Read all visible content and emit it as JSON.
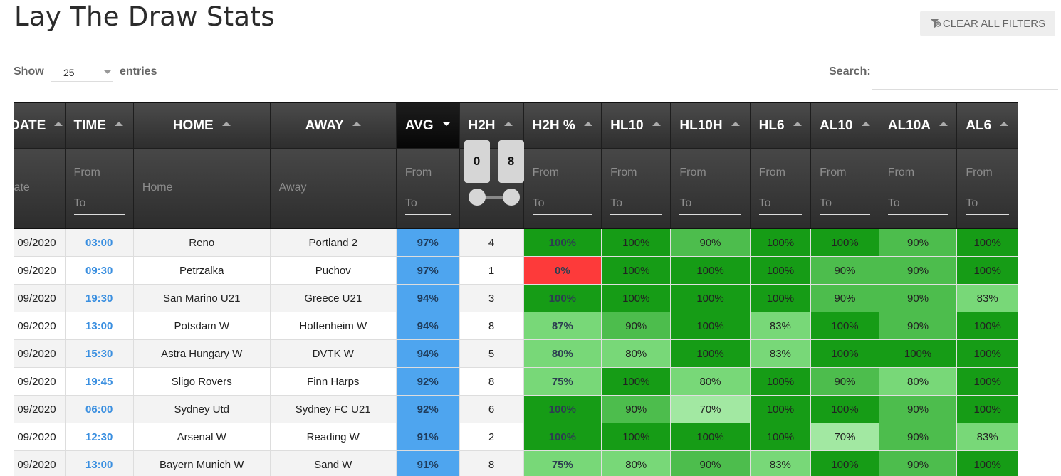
{
  "page": {
    "title": "Lay The Draw Stats",
    "clear_filters_label": "CLEAR ALL FILTERS",
    "clear_filters_icon": "filter-clear-icon"
  },
  "length": {
    "show_label": "Show",
    "selected": "25",
    "entries_label": "entries"
  },
  "search": {
    "label": "Search:",
    "value": "",
    "placeholder": ""
  },
  "columns": [
    {
      "key": "date",
      "label": "DATE",
      "sort": "asc"
    },
    {
      "key": "time",
      "label": "TIME",
      "sort": "asc"
    },
    {
      "key": "home",
      "label": "HOME",
      "sort": "asc"
    },
    {
      "key": "away",
      "label": "AWAY",
      "sort": "asc"
    },
    {
      "key": "avg",
      "label": "AVG",
      "sort": "desc"
    },
    {
      "key": "h2h",
      "label": "H2H",
      "sort": "asc"
    },
    {
      "key": "h2hp",
      "label": "H2H %",
      "sort": "asc"
    },
    {
      "key": "hl10",
      "label": "HL10",
      "sort": "asc"
    },
    {
      "key": "hl10h",
      "label": "HL10H",
      "sort": "asc"
    },
    {
      "key": "hl6",
      "label": "HL6",
      "sort": "asc"
    },
    {
      "key": "al10",
      "label": "AL10",
      "sort": "asc"
    },
    {
      "key": "al10a",
      "label": "AL10A",
      "sort": "asc"
    },
    {
      "key": "al6",
      "label": "AL6",
      "sort": "asc"
    }
  ],
  "filters": {
    "date_placeholder": "Date",
    "from_placeholder": "From",
    "to_placeholder": "To",
    "home_placeholder": "Home",
    "away_placeholder": "Away",
    "h2h_range": {
      "min": "0",
      "max": "8"
    }
  },
  "colors": {
    "avg": "#4ea5ef",
    "p100": "#169c16",
    "p90": "#4dbd4d",
    "p80": "#78d878",
    "p70": "#a2e8a2",
    "p0": "#fd3a3a",
    "time": "#3a8fe0"
  },
  "rows": [
    {
      "date": "09/2020",
      "time": "03:00",
      "home": "Reno",
      "away": "Portland 2",
      "avg": "97%",
      "h2h": "4",
      "h2hp": "100%",
      "hl10": "100%",
      "hl10h": "90%",
      "hl6": "100%",
      "al10": "100%",
      "al10a": "90%",
      "al6": "100%"
    },
    {
      "date": "09/2020",
      "time": "09:30",
      "home": "Petrzalka",
      "away": "Puchov",
      "avg": "97%",
      "h2h": "1",
      "h2hp": "0%",
      "hl10": "100%",
      "hl10h": "100%",
      "hl6": "100%",
      "al10": "90%",
      "al10a": "90%",
      "al6": "100%"
    },
    {
      "date": "09/2020",
      "time": "19:30",
      "home": "San Marino U21",
      "away": "Greece U21",
      "avg": "94%",
      "h2h": "3",
      "h2hp": "100%",
      "hl10": "100%",
      "hl10h": "100%",
      "hl6": "100%",
      "al10": "90%",
      "al10a": "90%",
      "al6": "83%"
    },
    {
      "date": "09/2020",
      "time": "13:00",
      "home": "Potsdam W",
      "away": "Hoffenheim W",
      "avg": "94%",
      "h2h": "8",
      "h2hp": "87%",
      "hl10": "90%",
      "hl10h": "100%",
      "hl6": "83%",
      "al10": "100%",
      "al10a": "90%",
      "al6": "100%"
    },
    {
      "date": "09/2020",
      "time": "15:30",
      "home": "Astra Hungary W",
      "away": "DVTK W",
      "avg": "94%",
      "h2h": "5",
      "h2hp": "80%",
      "hl10": "80%",
      "hl10h": "100%",
      "hl6": "83%",
      "al10": "100%",
      "al10a": "100%",
      "al6": "100%"
    },
    {
      "date": "09/2020",
      "time": "19:45",
      "home": "Sligo Rovers",
      "away": "Finn Harps",
      "avg": "92%",
      "h2h": "8",
      "h2hp": "75%",
      "hl10": "100%",
      "hl10h": "80%",
      "hl6": "100%",
      "al10": "90%",
      "al10a": "80%",
      "al6": "100%"
    },
    {
      "date": "09/2020",
      "time": "06:00",
      "home": "Sydney Utd",
      "away": "Sydney FC U21",
      "avg": "92%",
      "h2h": "6",
      "h2hp": "100%",
      "hl10": "90%",
      "hl10h": "70%",
      "hl6": "100%",
      "al10": "100%",
      "al10a": "90%",
      "al6": "100%"
    },
    {
      "date": "09/2020",
      "time": "12:30",
      "home": "Arsenal W",
      "away": "Reading W",
      "avg": "91%",
      "h2h": "2",
      "h2hp": "100%",
      "hl10": "100%",
      "hl10h": "100%",
      "hl6": "100%",
      "al10": "70%",
      "al10a": "90%",
      "al6": "83%"
    },
    {
      "date": "09/2020",
      "time": "13:00",
      "home": "Bayern Munich W",
      "away": "Sand W",
      "avg": "91%",
      "h2h": "8",
      "h2hp": "75%",
      "hl10": "80%",
      "hl10h": "90%",
      "hl6": "83%",
      "al10": "100%",
      "al10a": "90%",
      "al6": "100%"
    }
  ]
}
